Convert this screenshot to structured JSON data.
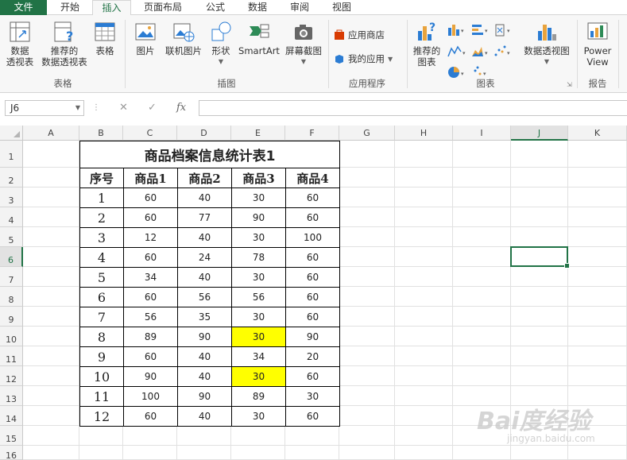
{
  "tabs": [
    "文件",
    "开始",
    "插入",
    "页面布局",
    "公式",
    "数据",
    "审阅",
    "视图"
  ],
  "ribbon": {
    "groups": {
      "tables": "表格",
      "illustrations": "插图",
      "apps": "应用程序",
      "charts": "图表",
      "reports": "报告"
    },
    "buttons": {
      "pivot_table": "数据\n透视表",
      "recommended_pivot": "推荐的\n数据透视表",
      "table": "表格",
      "picture": "图片",
      "online_picture": "联机图片",
      "shapes": "形状",
      "smartart": "SmartArt",
      "screenshot": "屏幕截图",
      "store": "应用商店",
      "my_apps": "我的应用",
      "recommended_charts": "推荐的\n图表",
      "pivot_chart": "数据透视图",
      "power_view": "Power\nView"
    }
  },
  "formula_bar": {
    "name_box": "J6",
    "cancel": "✕",
    "enter": "✓",
    "fx": "fx",
    "content": ""
  },
  "grid": {
    "columns": [
      "A",
      "B",
      "C",
      "D",
      "E",
      "F",
      "G",
      "H",
      "I",
      "J",
      "K"
    ],
    "rows": [
      "1",
      "2",
      "3",
      "4",
      "5",
      "6",
      "7",
      "8",
      "9",
      "10",
      "11",
      "12",
      "13",
      "14",
      "15",
      "16"
    ],
    "selected_column": "J",
    "selected_row": "6"
  },
  "table": {
    "title": "商品档案信息统计表1",
    "headers": [
      "序号",
      "商品1",
      "商品2",
      "商品3",
      "商品4"
    ],
    "rows": [
      [
        "1",
        "60",
        "40",
        "30",
        "60"
      ],
      [
        "2",
        "60",
        "77",
        "90",
        "60"
      ],
      [
        "3",
        "12",
        "40",
        "30",
        "100"
      ],
      [
        "4",
        "60",
        "24",
        "78",
        "60"
      ],
      [
        "5",
        "34",
        "40",
        "30",
        "60"
      ],
      [
        "6",
        "60",
        "56",
        "56",
        "60"
      ],
      [
        "7",
        "56",
        "35",
        "30",
        "60"
      ],
      [
        "8",
        "89",
        "90",
        "30",
        "90"
      ],
      [
        "9",
        "60",
        "40",
        "34",
        "20"
      ],
      [
        "10",
        "90",
        "40",
        "30",
        "60"
      ],
      [
        "11",
        "100",
        "90",
        "89",
        "30"
      ],
      [
        "12",
        "60",
        "40",
        "30",
        "60"
      ]
    ],
    "highlighted_cells": [
      "E10",
      "E12"
    ],
    "highlight_color": "#ffff00"
  },
  "colors": {
    "accent": "#217346"
  },
  "watermark": {
    "brand": "Baidu经验",
    "url": "jingyan.baidu.com"
  }
}
